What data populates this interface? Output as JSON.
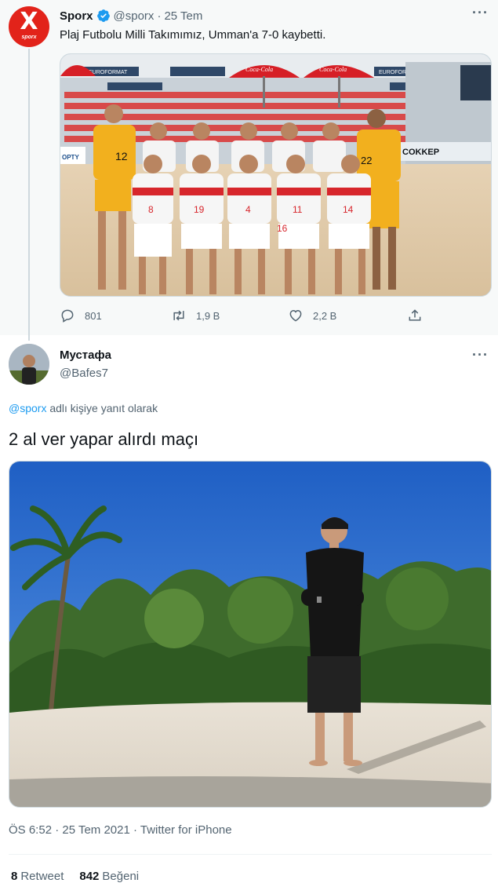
{
  "parent_tweet": {
    "avatar_text": "X",
    "avatar_subtext": "sporx",
    "name": "Sporx",
    "handle": "@sporx",
    "date": "25 Tem",
    "separator": "·",
    "more": "···",
    "text": "Plaj Futbolu Milli Takımımız, Umman'a 7-0 kaybetti.",
    "actions": {
      "replies": "801",
      "retweets": "1,9 B",
      "likes": "2,2 B"
    },
    "media": {
      "banner_top": "EUROFORMAT",
      "umbrella_text": "Coca-Cola",
      "board_right": "COKKEP",
      "board_left": "OPTY",
      "jersey_numbers": [
        "12",
        "22",
        "8",
        "19",
        "4",
        "11",
        "14",
        "16"
      ]
    }
  },
  "reply_tweet": {
    "name": "Мустафа",
    "handle": "@Bafes7",
    "more": "···",
    "replying_mention": "@sporx",
    "replying_rest": " adlı kişiye yanıt olarak",
    "text": "2 al ver yapar alırdı maçı",
    "timestamp": "ÖS 6:52 · 25 Tem 2021 · Twitter for iPhone",
    "retweets_count": "8",
    "retweets_label": "Retweet",
    "likes_count": "842",
    "likes_label": "Beğeni"
  },
  "colors": {
    "accent": "#1d9bf0",
    "secondary_text": "#536471",
    "sporx_red": "#e2231a"
  }
}
